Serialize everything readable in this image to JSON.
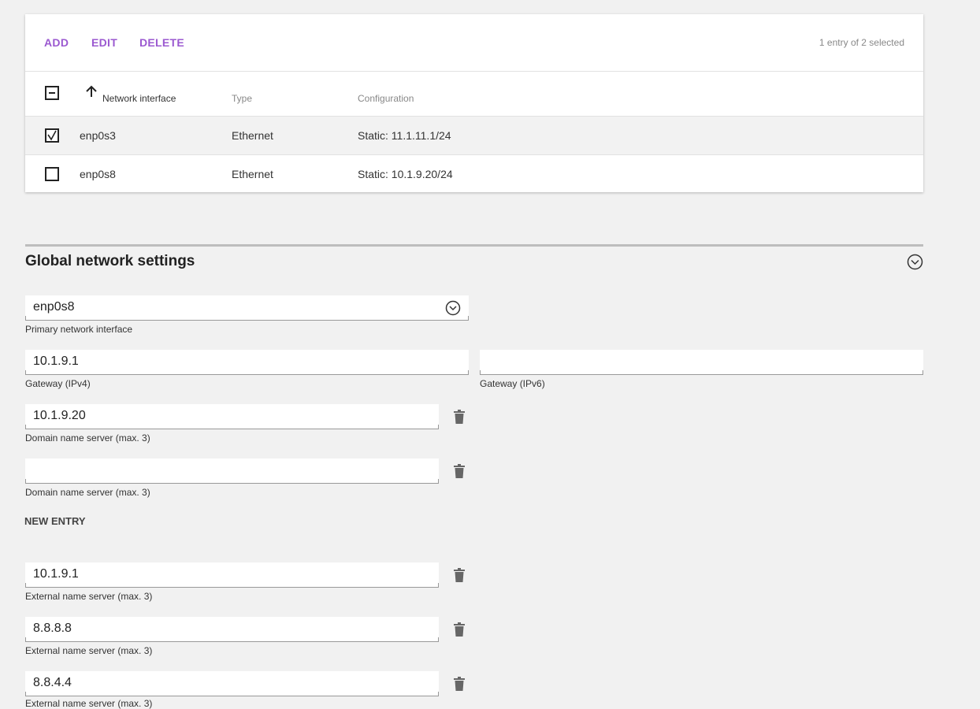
{
  "toolbar": {
    "add_label": "ADD",
    "edit_label": "EDIT",
    "delete_label": "DELETE",
    "selection_info": "1 entry of 2 selected",
    "accent_color": "#9b59d0"
  },
  "table": {
    "headers": {
      "interface": "Network interface",
      "type": "Type",
      "configuration": "Configuration"
    },
    "sort_icon": "arrow-up-icon",
    "rows": [
      {
        "checked": true,
        "interface": "enp0s3",
        "type": "Ethernet",
        "configuration": "Static: 11.1.11.1/24"
      },
      {
        "checked": false,
        "interface": "enp0s8",
        "type": "Ethernet",
        "configuration": "Static: 10.1.9.20/24"
      }
    ]
  },
  "global": {
    "title": "Global network settings",
    "primary_interface": {
      "value": "enp0s8",
      "label": "Primary network interface"
    },
    "gateway_ipv4": {
      "value": "10.1.9.1",
      "label": "Gateway (IPv4)"
    },
    "gateway_ipv6": {
      "value": "",
      "label": "Gateway (IPv6)"
    },
    "dns": [
      {
        "value": "10.1.9.20",
        "label": "Domain name server (max. 3)"
      },
      {
        "value": "",
        "label": "Domain name server (max. 3)"
      }
    ],
    "new_entry_label": "NEW ENTRY",
    "external_dns": [
      {
        "value": "10.1.9.1",
        "label": "External name server (max. 3)"
      },
      {
        "value": "8.8.8.8",
        "label": "External name server (max. 3)"
      },
      {
        "value": "8.8.4.4",
        "label": "External name server (max. 3)"
      }
    ]
  }
}
